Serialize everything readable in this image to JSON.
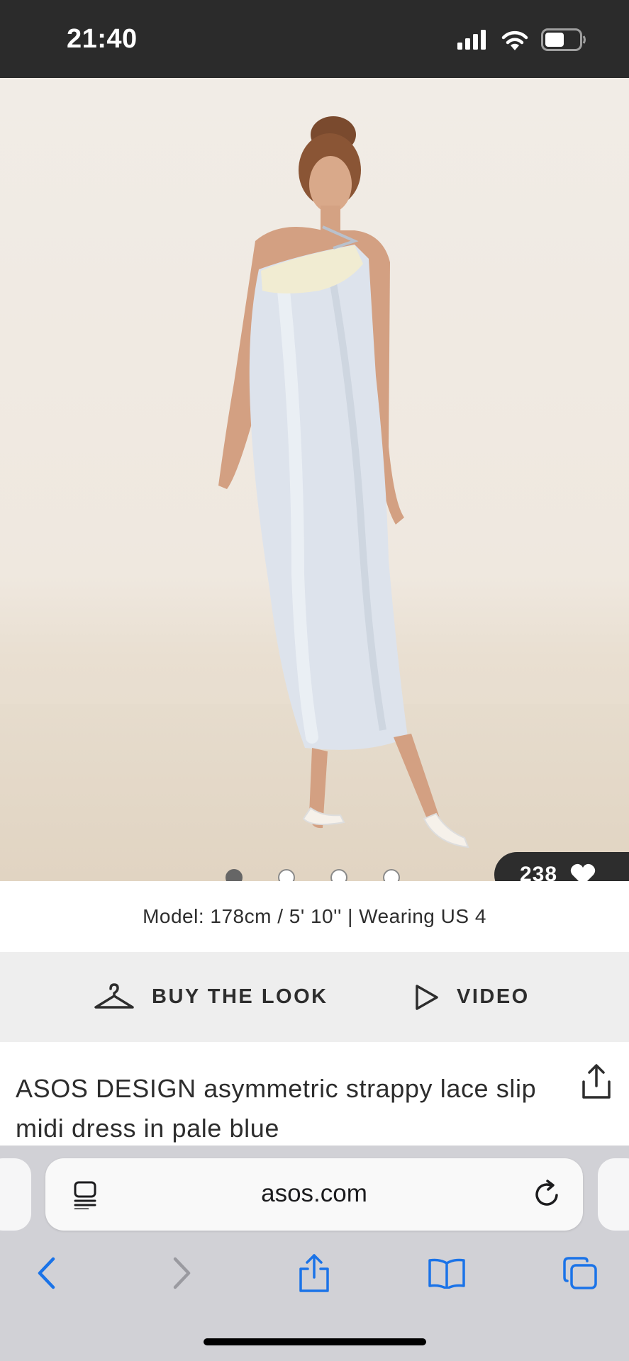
{
  "status_bar": {
    "time": "21:40"
  },
  "gallery": {
    "dots": [
      {
        "active": true
      },
      {
        "active": false
      },
      {
        "active": false
      },
      {
        "active": false
      }
    ],
    "likes_count": "238"
  },
  "model_info": "Model: 178cm / 5' 10'' | Wearing US 4",
  "actions": {
    "buy_the_look": "BUY THE LOOK",
    "video": "VIDEO"
  },
  "product": {
    "title": "ASOS DESIGN asymmetric strappy lace slip midi dress in pale blue"
  },
  "browser": {
    "url": "asos.com"
  },
  "colors": {
    "status_bar_bg": "#2b2b2b",
    "action_bar_bg": "#eeeeee",
    "text_primary": "#2d2d2d",
    "ios_blue": "#1a73e8",
    "browser_bg": "#d1d1d6"
  },
  "icons": {
    "signal": "signal-icon",
    "wifi": "wifi-icon",
    "battery": "battery-icon",
    "heart": "heart-icon",
    "hanger": "hanger-icon",
    "play": "play-icon",
    "share": "share-icon",
    "reader": "reader-mode-icon",
    "reload": "reload-icon",
    "back": "back-icon",
    "forward": "forward-icon",
    "browser_share": "share-icon",
    "bookmarks": "bookmarks-icon",
    "tabs": "tabs-icon"
  }
}
